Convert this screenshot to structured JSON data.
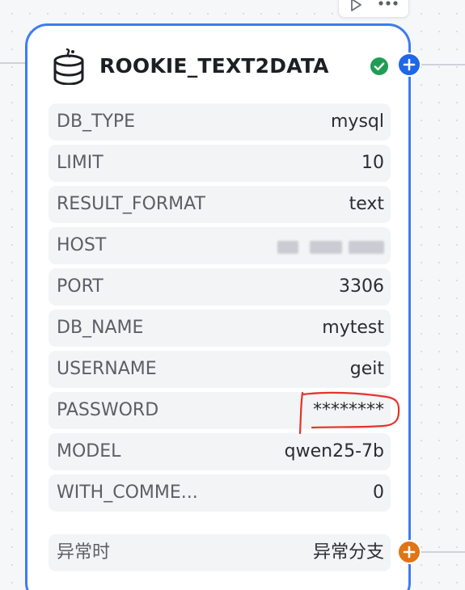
{
  "node": {
    "title": "ROOKIE_TEXT2DATA",
    "icon": "database-icon",
    "status_icon": "check-circle-icon",
    "colors": {
      "border": "#3f7cf0",
      "status": "#1f9d55",
      "port_top": "#1f66e8",
      "port_bottom": "#e07515"
    }
  },
  "params": [
    {
      "label": "DB_TYPE",
      "value": "mysql"
    },
    {
      "label": "LIMIT",
      "value": "10"
    },
    {
      "label": "RESULT_FORMAT",
      "value": "text"
    },
    {
      "label": "HOST",
      "value": ""
    },
    {
      "label": "PORT",
      "value": "3306"
    },
    {
      "label": "DB_NAME",
      "value": "mytest"
    },
    {
      "label": "USERNAME",
      "value": "geit"
    },
    {
      "label": "PASSWORD",
      "value": "********"
    },
    {
      "label": "MODEL",
      "value": "qwen25-7b"
    },
    {
      "label": "WITH_COMME...",
      "value": "0"
    }
  ],
  "exception": {
    "label": "异常时",
    "value": "异常分支"
  }
}
